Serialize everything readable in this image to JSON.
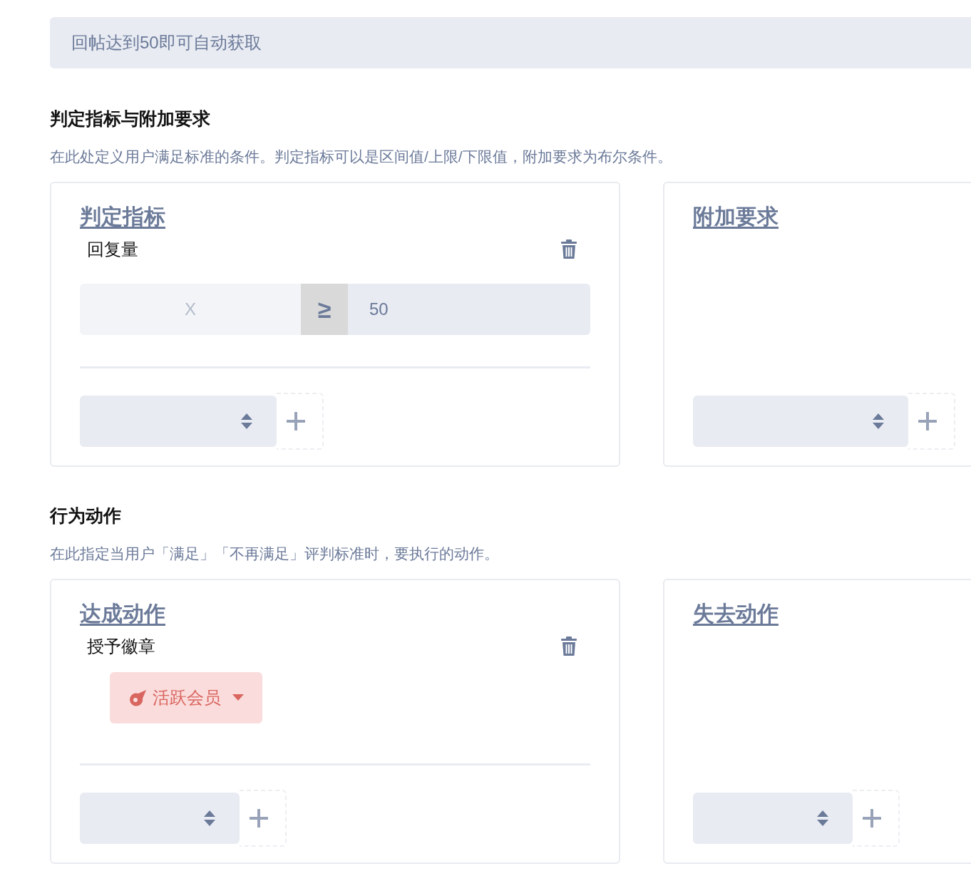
{
  "notice": "回帖达到50即可自动获取",
  "sections": [
    {
      "title": "判定指标与附加要求",
      "description": "在此处定义用户满足标准的条件。判定指标可以是区间值/上限/下限值，附加要求为布尔条件。",
      "panels": [
        {
          "title": "判定指标",
          "items": [
            {
              "kind": "range",
              "label": "回复量",
              "placeholder": "X",
              "operator": "≥",
              "value": "50"
            }
          ]
        },
        {
          "title": "附加要求"
        }
      ]
    },
    {
      "title": "行为动作",
      "description": "在此指定当用户「满足」「不再满足」评判标准时，要执行的动作。",
      "panels": [
        {
          "title": "达成动作",
          "items": [
            {
              "kind": "badge",
              "label": "授予徽章",
              "badge": "活跃会员"
            }
          ]
        },
        {
          "title": "失去动作"
        }
      ]
    }
  ]
}
